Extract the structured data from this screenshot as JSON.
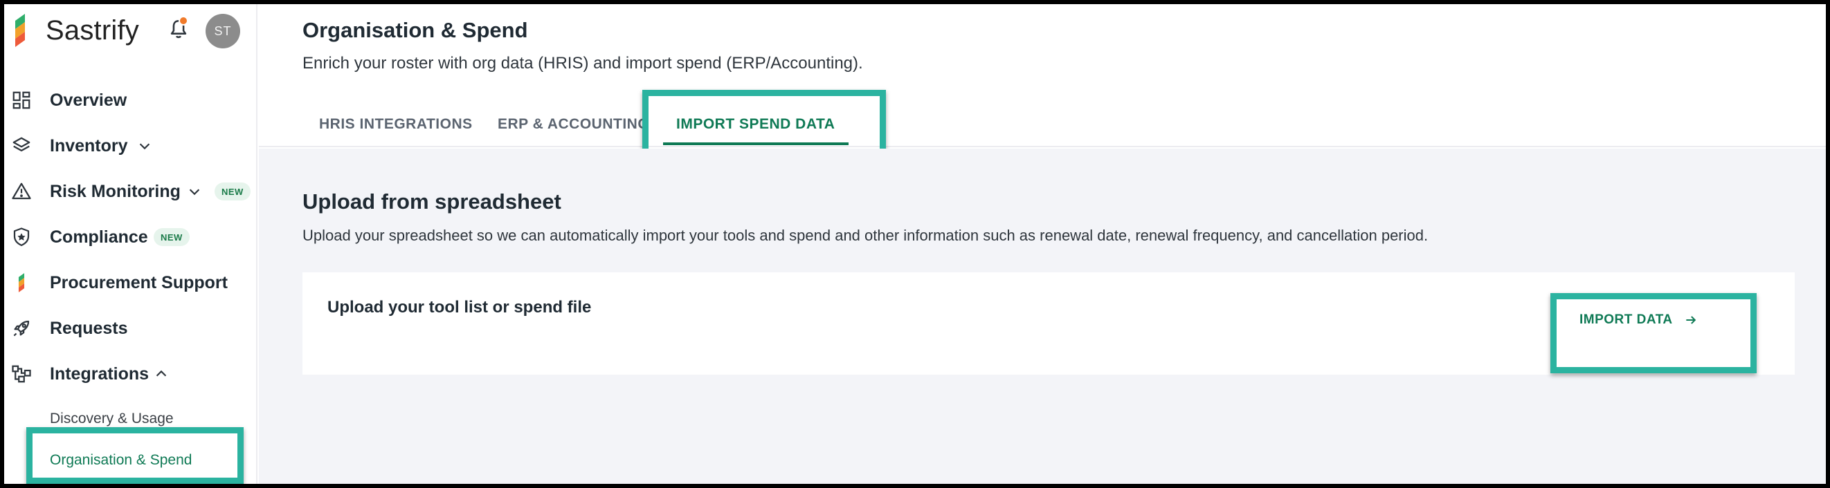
{
  "app": {
    "name": "Sastrify"
  },
  "user": {
    "initials": "ST"
  },
  "sidebar": {
    "items": [
      {
        "label": "Overview",
        "icon": "dashboard-icon"
      },
      {
        "label": "Inventory",
        "icon": "layers-icon",
        "expandable": true
      },
      {
        "label": "Risk Monitoring",
        "icon": "warning-icon",
        "expandable": true,
        "badge": "NEW"
      },
      {
        "label": "Compliance",
        "icon": "shield-star-icon",
        "badge": "NEW"
      },
      {
        "label": "Procurement Support",
        "icon": "sastrify-logo-icon"
      },
      {
        "label": "Requests",
        "icon": "rocket-icon"
      },
      {
        "label": "Integrations",
        "icon": "integrations-icon",
        "expanded": true
      }
    ],
    "sub_items": [
      {
        "label": "Discovery & Usage"
      },
      {
        "label": "Organisation & Spend",
        "active": true
      }
    ]
  },
  "header": {
    "title": "Organisation & Spend",
    "subtitle": "Enrich your roster with org data (HRIS) and import spend (ERP/Accounting).",
    "tabs": [
      {
        "label": "HRIS INTEGRATIONS"
      },
      {
        "label": "ERP & ACCOUNTING"
      },
      {
        "label": "IMPORT SPEND DATA",
        "active": true
      }
    ]
  },
  "main": {
    "section_title": "Upload from spreadsheet",
    "section_desc": "Upload your spreadsheet so we can automatically import your tools and spend and other information such as renewal date, renewal frequency, and cancellation period.",
    "card_title": "Upload your tool list or spend file",
    "import_button": "IMPORT DATA"
  },
  "colors": {
    "accent": "#0f7a55",
    "highlight": "#2bb3a0",
    "badge_bg": "#e6f4ec",
    "notification": "#f07a2a"
  }
}
